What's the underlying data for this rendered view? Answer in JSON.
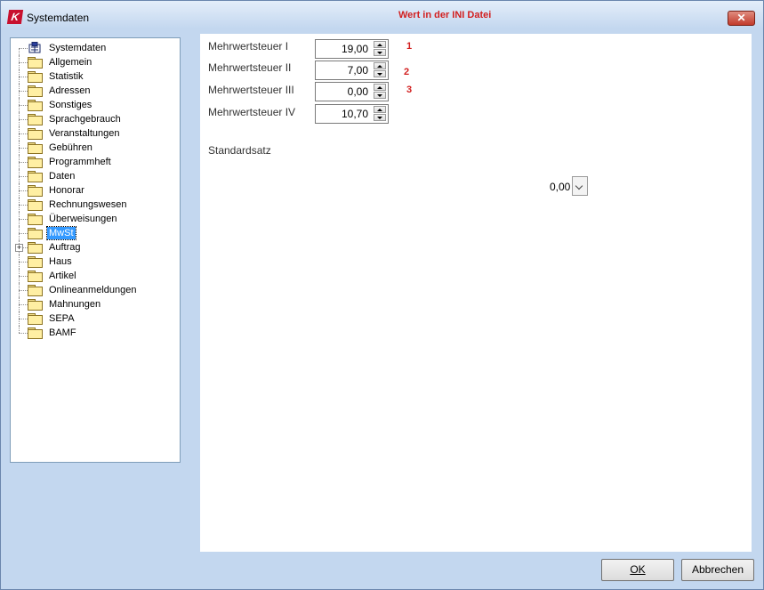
{
  "window": {
    "title": "Systemdaten",
    "logo_text": "K",
    "ini_note": "Wert in der INI Datei",
    "close_glyph": "✕"
  },
  "tree": {
    "items": [
      {
        "label": "Systemdaten",
        "icon": "database-icon"
      },
      {
        "label": "Allgemein",
        "icon": "folder-icon"
      },
      {
        "label": "Statistik",
        "icon": "folder-icon"
      },
      {
        "label": "Adressen",
        "icon": "folder-icon"
      },
      {
        "label": "Sonstiges",
        "icon": "folder-icon"
      },
      {
        "label": "Sprachgebrauch",
        "icon": "folder-icon"
      },
      {
        "label": "Veranstaltungen",
        "icon": "folder-icon"
      },
      {
        "label": "Gebühren",
        "icon": "folder-icon"
      },
      {
        "label": "Programmheft",
        "icon": "folder-icon"
      },
      {
        "label": "Daten",
        "icon": "folder-icon"
      },
      {
        "label": "Honorar",
        "icon": "folder-icon"
      },
      {
        "label": "Rechnungswesen",
        "icon": "folder-icon"
      },
      {
        "label": "Überweisungen",
        "icon": "folder-icon"
      },
      {
        "label": "MwSt",
        "icon": "folder-icon",
        "selected": true
      },
      {
        "label": "Auftrag",
        "icon": "folder-icon",
        "expandable": true
      },
      {
        "label": "Haus",
        "icon": "folder-icon"
      },
      {
        "label": "Artikel",
        "icon": "folder-icon"
      },
      {
        "label": "Onlineanmeldungen",
        "icon": "folder-icon"
      },
      {
        "label": "Mahnungen",
        "icon": "folder-icon"
      },
      {
        "label": "SEPA",
        "icon": "folder-icon"
      },
      {
        "label": "BAMF",
        "icon": "folder-icon"
      }
    ]
  },
  "form": {
    "vat": [
      {
        "label": "Mehrwertsteuer I",
        "value": "19,00",
        "note": "1"
      },
      {
        "label": "Mehrwertsteuer II",
        "value": "7,00",
        "note": "2"
      },
      {
        "label": "Mehrwertsteuer III",
        "value": "0,00",
        "note": "3"
      },
      {
        "label": "Mehrwertsteuer IV",
        "value": "10,70",
        "note": ""
      }
    ],
    "standard": {
      "label": "Standardsatz",
      "value": "0,00"
    }
  },
  "buttons": {
    "ok": "OK",
    "cancel": "Abbrechen"
  },
  "colors": {
    "note_red": "#d21f1f",
    "selection": "#3399ff",
    "window_bg": "#c3d7ef"
  }
}
